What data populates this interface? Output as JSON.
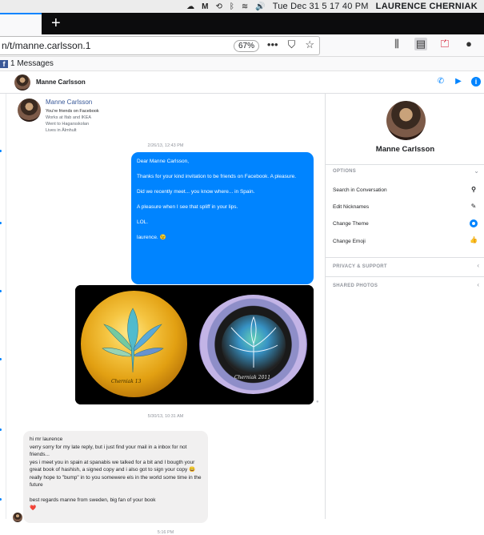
{
  "system": {
    "menubar_icons": [
      "creative-cloud-icon",
      "malwarebytes-icon",
      "time-machine-icon",
      "bluetooth-icon",
      "wifi-icon",
      "volume-icon"
    ],
    "clock": "Tue Dec 31  5 17 40 PM",
    "user": "LAURENCE CHERNIAK"
  },
  "browser": {
    "new_tab_label": "+",
    "url": "n/t/manne.carlsson.1",
    "zoom": "67%",
    "bookmark": "1 Messages"
  },
  "conversation": {
    "name": "Manne Carlsson",
    "intro": {
      "name": "Manne Carlsson",
      "friends_line": "You're friends on Facebook",
      "work": "Works at Ifab and IKEA",
      "school": "Went to Hagarsskolan",
      "lives": "Lives in Älmhult"
    },
    "timestamps": [
      "2/26/13, 12:43 PM",
      "5/30/13, 10:31 AM",
      "5:16 PM"
    ],
    "outgoing": [
      "Dear Manne Carlsson,",
      "Thanks for your kind invitation to be friends on Facebook. A pleasure.",
      "Did we recently meet... you know where... in Spain.",
      "A pleasure when I see that spliff in your lips.",
      "LOL.",
      "laurence.   😉"
    ],
    "image_signatures": [
      "Cherniak 13",
      "Cherniak 2011"
    ],
    "incoming": [
      "hi mr laurence",
      "verry sorry for my late reply, but i just find your mail in a inbox for not friends...",
      "yes i meet you in spain at spanabis we talked for a bit and I bougth your great book of hashish, a signed copy and i also got to sign your copy 😀",
      "really hope to \"bump\" in to you somewere els in the world some time in the future",
      "",
      "best regards manne from sweden, big fan of your book",
      "❤️"
    ]
  },
  "panel": {
    "name": "Manne Carlsson",
    "options_header": "OPTIONS",
    "items": [
      {
        "label": "Search in Conversation",
        "icon": "search-icon"
      },
      {
        "label": "Edit Nicknames",
        "icon": "pencil-icon"
      },
      {
        "label": "Change Theme",
        "icon": "theme-icon"
      },
      {
        "label": "Change Emoji",
        "icon": "thumbs-up-icon"
      }
    ],
    "privacy_header": "PRIVACY & SUPPORT",
    "photos_header": "SHARED PHOTOS"
  },
  "colors": {
    "messenger_blue": "#0084ff",
    "facebook_blue": "#3b5998",
    "incoming_bubble": "#f1f0f0"
  }
}
